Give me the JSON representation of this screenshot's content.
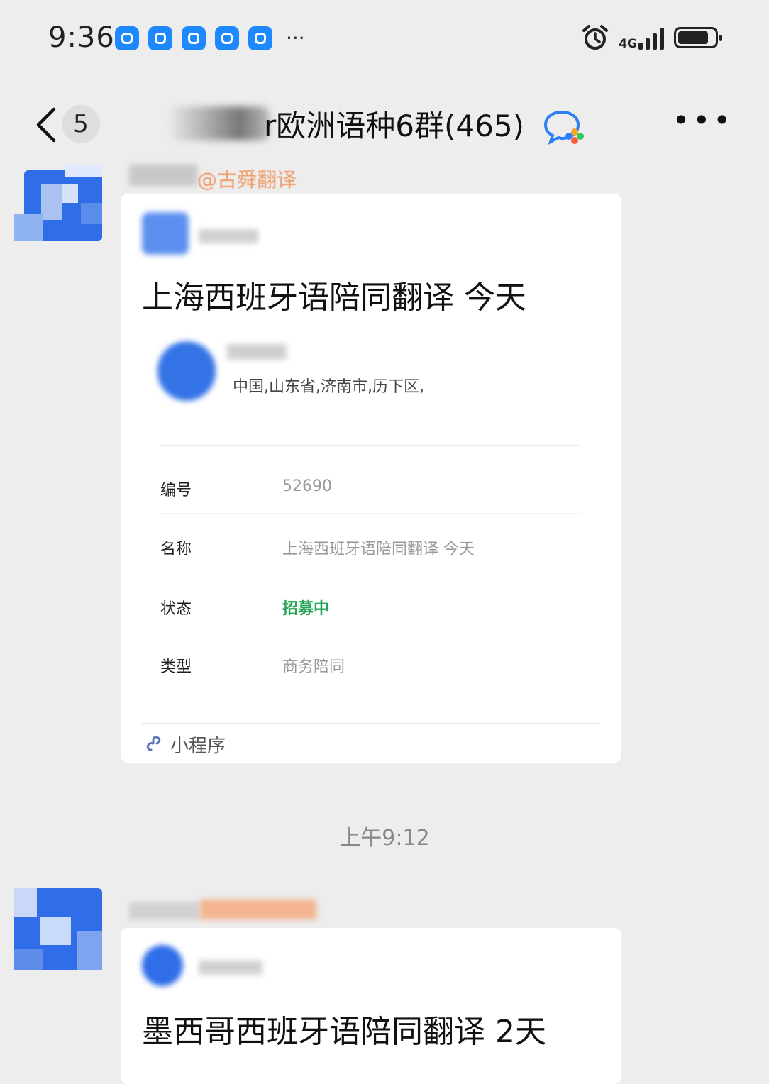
{
  "status_bar": {
    "time": "9:36",
    "network": "4G",
    "app_icons": [
      "message-app-icon",
      "hand-app-icon",
      "bulb-app-icon",
      "alipay-app-icon",
      "search-app-icon"
    ],
    "more": "···"
  },
  "nav": {
    "unread_count": "5",
    "title": "r欧洲语种6群(465)",
    "more": "•••"
  },
  "messages": [
    {
      "sender_visible": "@古舜翻译",
      "card": {
        "title": "上海西班牙语陪同翻译  今天",
        "location": "中国,山东省,济南市,历下区,",
        "fields": [
          {
            "label": "编号",
            "value": "52690"
          },
          {
            "label": "名称",
            "value": "上海西班牙语陪同翻译 今天"
          },
          {
            "label": "状态",
            "value": "招募中",
            "status_color": "#25a556"
          },
          {
            "label": "类型",
            "value": "商务陪同"
          }
        ],
        "footer": "小程序"
      }
    },
    {
      "card": {
        "title": "墨西哥西班牙语陪同翻译  2天"
      }
    }
  ],
  "timestamp": "上午9:12",
  "colors": {
    "background": "#ededed",
    "card": "#ffffff",
    "status_green": "#25a556",
    "sender_orange": "#f0884a"
  }
}
